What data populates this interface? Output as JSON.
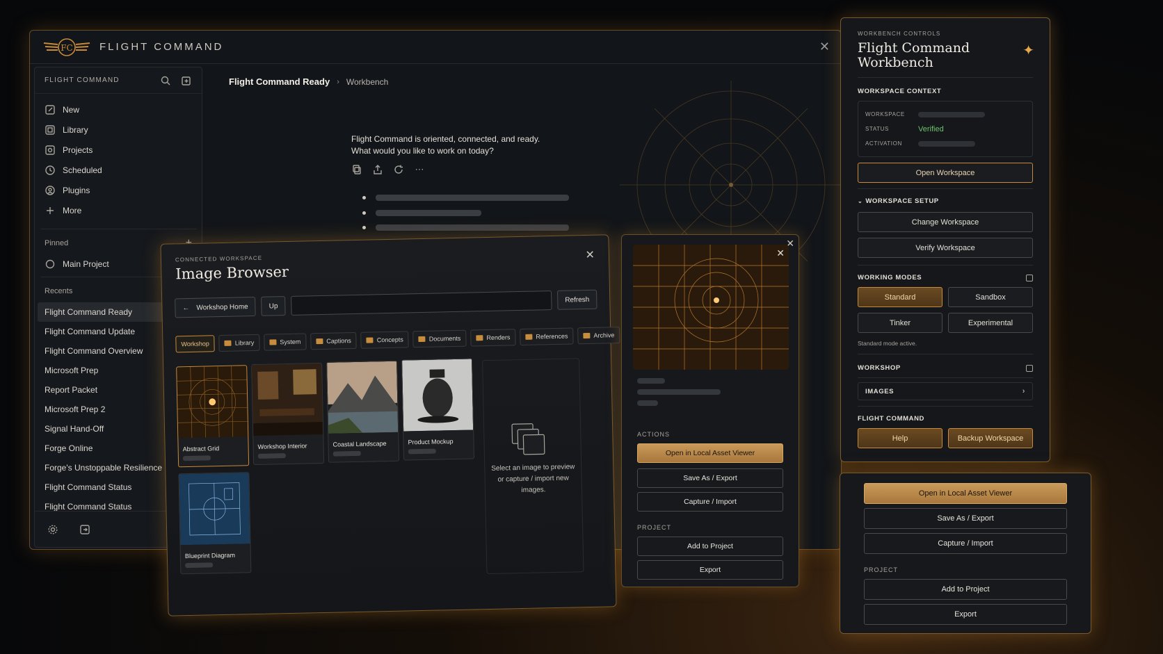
{
  "app": {
    "title": "FLIGHT COMMAND",
    "logo_text": "FC"
  },
  "sidebar": {
    "header": "FLIGHT COMMAND",
    "nav": [
      {
        "label": "New",
        "icon": "edit-icon"
      },
      {
        "label": "Library",
        "icon": "library-icon"
      },
      {
        "label": "Projects",
        "icon": "projects-icon"
      },
      {
        "label": "Scheduled",
        "icon": "clock-icon"
      },
      {
        "label": "Plugins",
        "icon": "plugins-icon"
      },
      {
        "label": "More",
        "icon": "more-icon"
      }
    ],
    "pinned_label": "Pinned",
    "pinned": [
      {
        "label": "Main Project"
      }
    ],
    "recents_label": "Recents",
    "recents": [
      "Flight Command Ready",
      "Flight Command Update",
      "Flight Command Overview",
      "Microsoft Prep",
      "Report Packet",
      "Microsoft Prep 2",
      "Signal Hand-Off",
      "Forge Online",
      "Forge's Unstoppable Resilience",
      "Flight Command Status",
      "Flight Command Status"
    ]
  },
  "content": {
    "breadcrumb": [
      "Flight Command Ready",
      "Workbench"
    ],
    "message_line1": "Flight Command is oriented, connected, and ready.",
    "message_line2": "What would you like to work on today?"
  },
  "image_browser": {
    "eyebrow": "CONNECTED WORKSPACE",
    "title": "Image Browser",
    "home_label": "Workshop Home",
    "up_label": "Up",
    "refresh_label": "Refresh",
    "tabs": [
      "Workshop",
      "Library",
      "System",
      "Captions",
      "Concepts",
      "Documents",
      "Renders",
      "References",
      "Archive"
    ],
    "thumbnails": [
      "Abstract Grid",
      "Workshop Interior",
      "Coastal Landscape",
      "Product Mockup",
      "Blueprint Diagram"
    ],
    "preview_hint": "Select an image to preview or capture / import new images."
  },
  "asset_panel": {
    "actions_label": "ACTIONS",
    "open_label": "Open in Local Asset Viewer",
    "save_label": "Save As / Export",
    "capture_label": "Capture / Import",
    "project_label": "PROJECT",
    "add_label": "Add to Project",
    "export_label": "Export"
  },
  "workbench": {
    "eyebrow": "WORKBENCH CONTROLS",
    "title": "Flight Command Workbench",
    "context_label": "WORKSPACE CONTEXT",
    "ctx_workspace": "WORKSPACE",
    "ctx_status": "STATUS",
    "ctx_status_value": "Verified",
    "ctx_activation": "ACTIVATION",
    "open_workspace": "Open Workspace",
    "setup_label": "WORKSPACE SETUP",
    "change_workspace": "Change Workspace",
    "verify_workspace": "Verify Workspace",
    "modes_label": "WORKING MODES",
    "modes": [
      "Standard",
      "Sandbox",
      "Tinker",
      "Experimental"
    ],
    "mode_status": "Standard mode active.",
    "workshop_label": "WORKSHOP",
    "images_label": "IMAGES",
    "fc_label": "FLIGHT COMMAND",
    "help_label": "Help",
    "backup_label": "Backup Workspace"
  },
  "colors": {
    "accent": "#c98a3a",
    "status_ok": "#6cc36c",
    "background": "#121519"
  }
}
